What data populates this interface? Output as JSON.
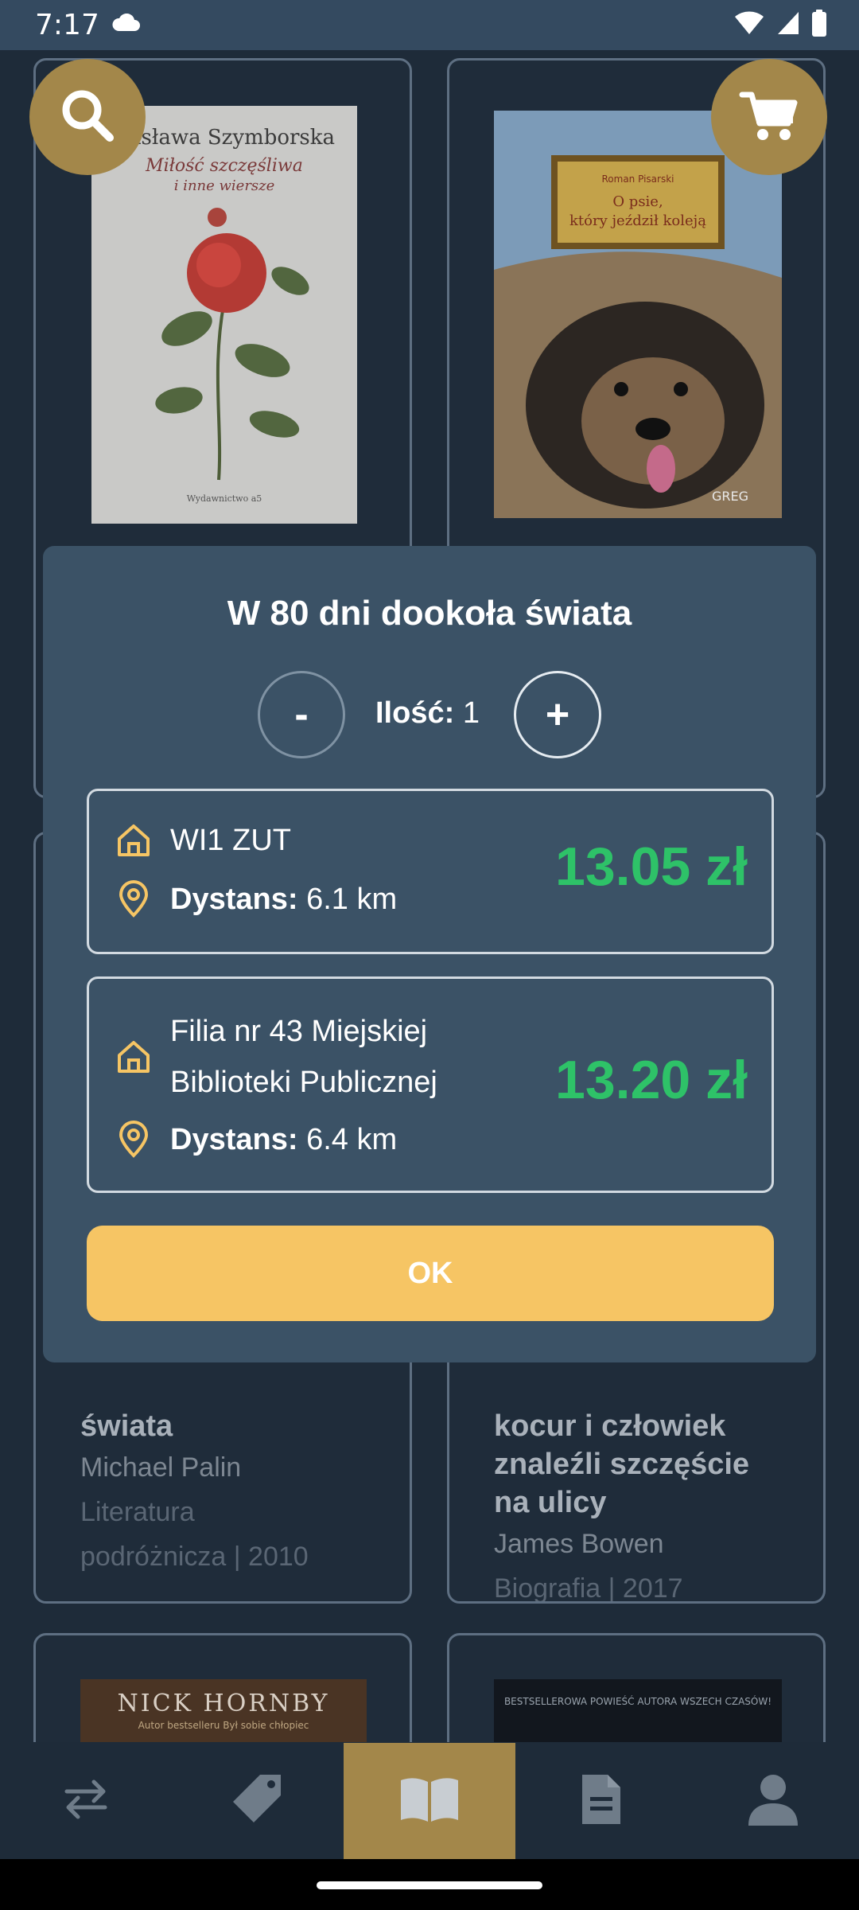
{
  "status_bar": {
    "time": "7:17"
  },
  "dialog": {
    "title": "W 80 dni dookoła świata",
    "decrement_label": "-",
    "increment_label": "+",
    "quantity_label": "Ilość:",
    "quantity_value": "1",
    "offers": [
      {
        "library": "WI1 ZUT",
        "distance_label": "Dystans:",
        "distance": "6.1 km",
        "price": "13.05 zł"
      },
      {
        "library_line1": "Filia nr 43 Miejskiej",
        "library_line2": "Biblioteki Publicznej",
        "distance_label": "Dystans:",
        "distance": "6.4 km",
        "price": "13.20 zł"
      }
    ],
    "ok_label": "OK"
  },
  "background_cards": [
    {
      "cover_author": "Wisława Szymborska",
      "cover_title_line1": "Miłość szczęśliwa",
      "cover_title_line2": "i inne wiersze",
      "cover_publisher": "Wydawnictwo a5"
    },
    {
      "cover_author": "Roman Pisarski",
      "cover_title_line1": "O psie,",
      "cover_title_line2": "który jeździł koleją",
      "cover_signature": "GREG"
    },
    {
      "title_tail": "świata",
      "author": "Michael Palin",
      "genre_line1": "Literatura",
      "genre_line2": "podróżnicza | 2010"
    },
    {
      "title_line1": "kocur i człowiek",
      "title_line2": "znaleźli szczęście",
      "title_line3": "na ulicy",
      "author": "James Bowen",
      "genre_line": "Biografia | 2017"
    },
    {
      "cover_author": "NICK HORNBY",
      "cover_subtitle": "Autor bestselleru Był sobie chłopiec"
    },
    {
      "cover_tagline": "BESTSELLEROWA POWIEŚĆ AUTORA WSZECH CZASÓW!"
    }
  ],
  "nav": {
    "active": "books"
  },
  "colors": {
    "accent": "#f6c564",
    "price": "#2ec268",
    "dialog_bg": "#3b5266",
    "icon": "#f6c564"
  }
}
